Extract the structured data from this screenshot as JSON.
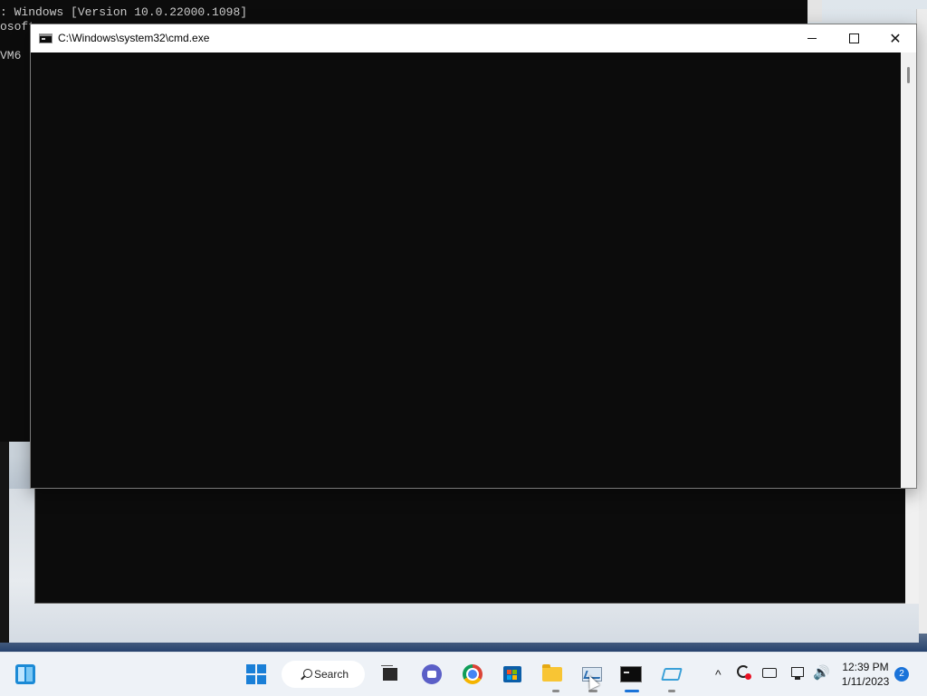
{
  "back_console": {
    "lines": [
      ": Windows [Version 10.0.22000.1098]",
      "osoft",
      "",
      "VM6"
    ]
  },
  "cmd_window": {
    "title": "C:\\Windows\\system32\\cmd.exe",
    "minimize_label": "—",
    "maximize_label": "☐",
    "close_label": "✕"
  },
  "taskbar": {
    "search_label": "Search",
    "apps": [
      "widgets-icon",
      "start-icon",
      "task-view-icon",
      "teams-chat-icon",
      "chrome-icon",
      "microsoft-store-icon",
      "file-explorer-icon",
      "performance-monitor-icon",
      "command-prompt-icon",
      "app-icon"
    ],
    "tray": {
      "chevron": "^",
      "volume": "🔊"
    },
    "clock": {
      "time": "12:39 PM",
      "date": "1/11/2023"
    },
    "notification_count": "2"
  },
  "colors": {
    "console_bg": "#0c0c0c",
    "accent": "#1a73d9"
  }
}
